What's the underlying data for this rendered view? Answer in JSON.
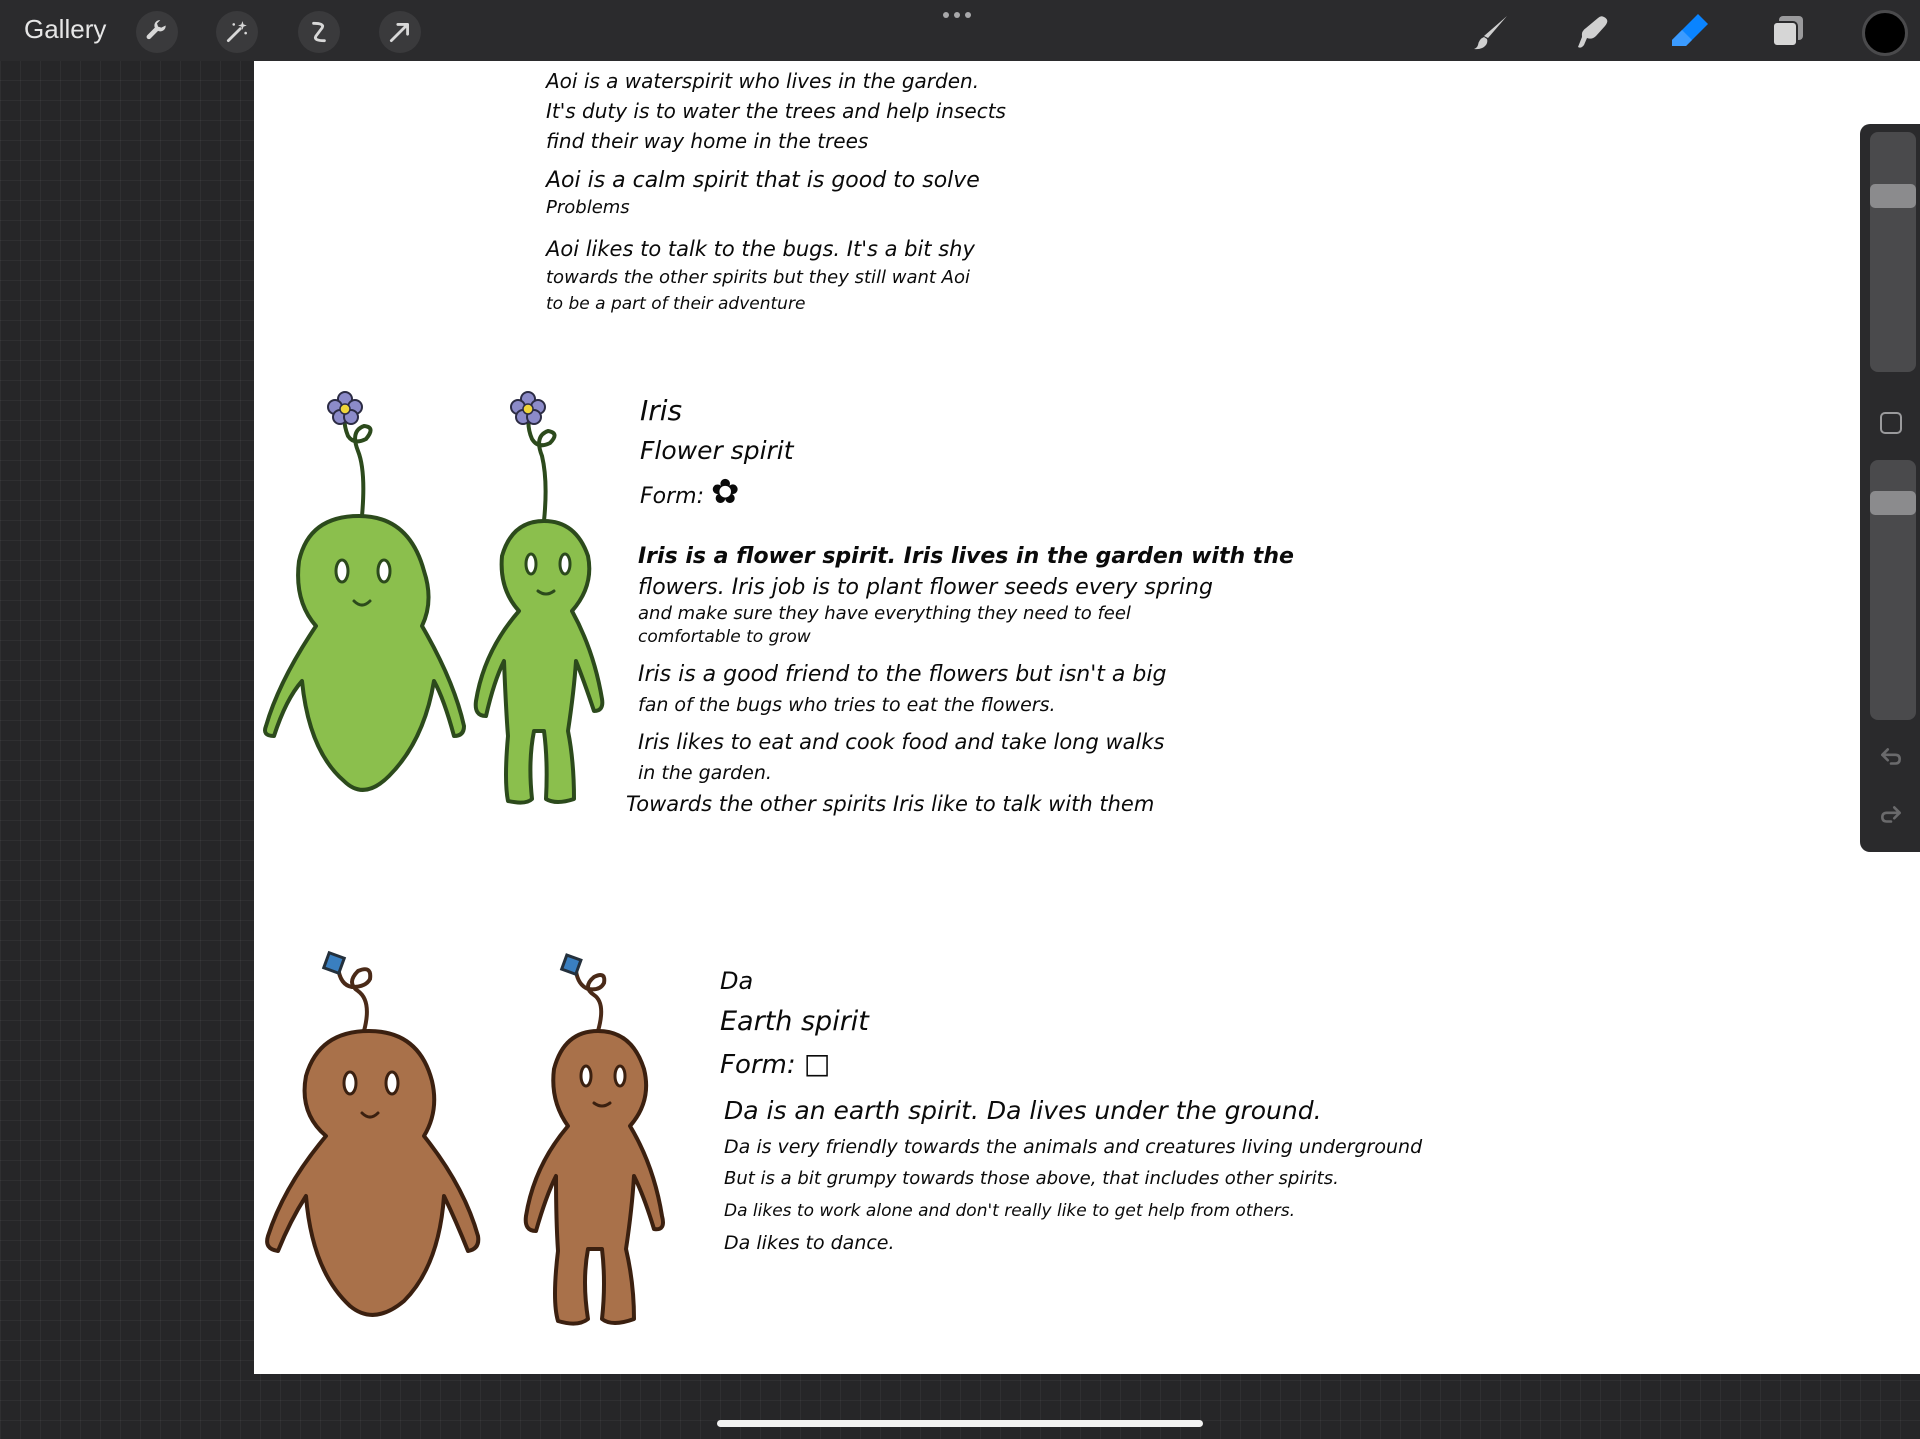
{
  "toolbar": {
    "gallery_label": "Gallery",
    "left_tools": [
      "wrench-icon",
      "magic-wand-icon",
      "selection-icon",
      "transform-arrow-icon"
    ],
    "right_tools": [
      "brush-icon",
      "smudge-icon",
      "eraser-icon",
      "layers-icon"
    ],
    "active_tool": "eraser-icon",
    "active_color": "#0a84ff",
    "current_color": "#000000"
  },
  "canvas": {
    "aoi": {
      "lines": [
        "Aoi is a waterspirit who lives in the garden.",
        "It's duty is to water the trees and help insects",
        "find their way home in the trees",
        "Aoi is a calm spirit that is good to solve",
        "Problems",
        "Aoi likes to talk to the bugs. It's a bit shy",
        "towards the other spirits but they still want Aoi",
        "to be a part of their adventure"
      ]
    },
    "iris": {
      "name": "Iris",
      "type": "Flower spirit",
      "form_label": "Form:",
      "form_symbol": "✿",
      "body_color": "#8bbf4d",
      "lines": [
        "Iris is a flower spirit. Iris lives in the garden with the",
        "flowers. Iris job is to plant flower seeds every spring",
        "and make sure they have everything they need to feel",
        "comfortable to grow",
        "Iris is a good friend to the flowers but isn't a big",
        "fan of the bugs who tries to eat the flowers.",
        "Iris likes to eat and cook food and take long walks",
        "in the garden.",
        "Towards the other spirits Iris like to talk with them"
      ]
    },
    "da": {
      "name": "Da",
      "type": "Earth spirit",
      "form_label": "Form:",
      "form_symbol": "□",
      "body_color": "#a9714a",
      "lines": [
        "Da is an earth spirit. Da lives under the ground.",
        "Da is very friendly towards the animals and creatures living underground",
        "But is a bit grumpy towards those above, that includes other spirits.",
        "Da likes to work alone and don't really like to get help from others.",
        "Da likes to dance."
      ]
    }
  },
  "sidebar": {
    "size_slider_value": 0.24,
    "opacity_slider_value": 0.13,
    "undo_icon": "undo-icon",
    "redo_icon": "redo-icon"
  }
}
